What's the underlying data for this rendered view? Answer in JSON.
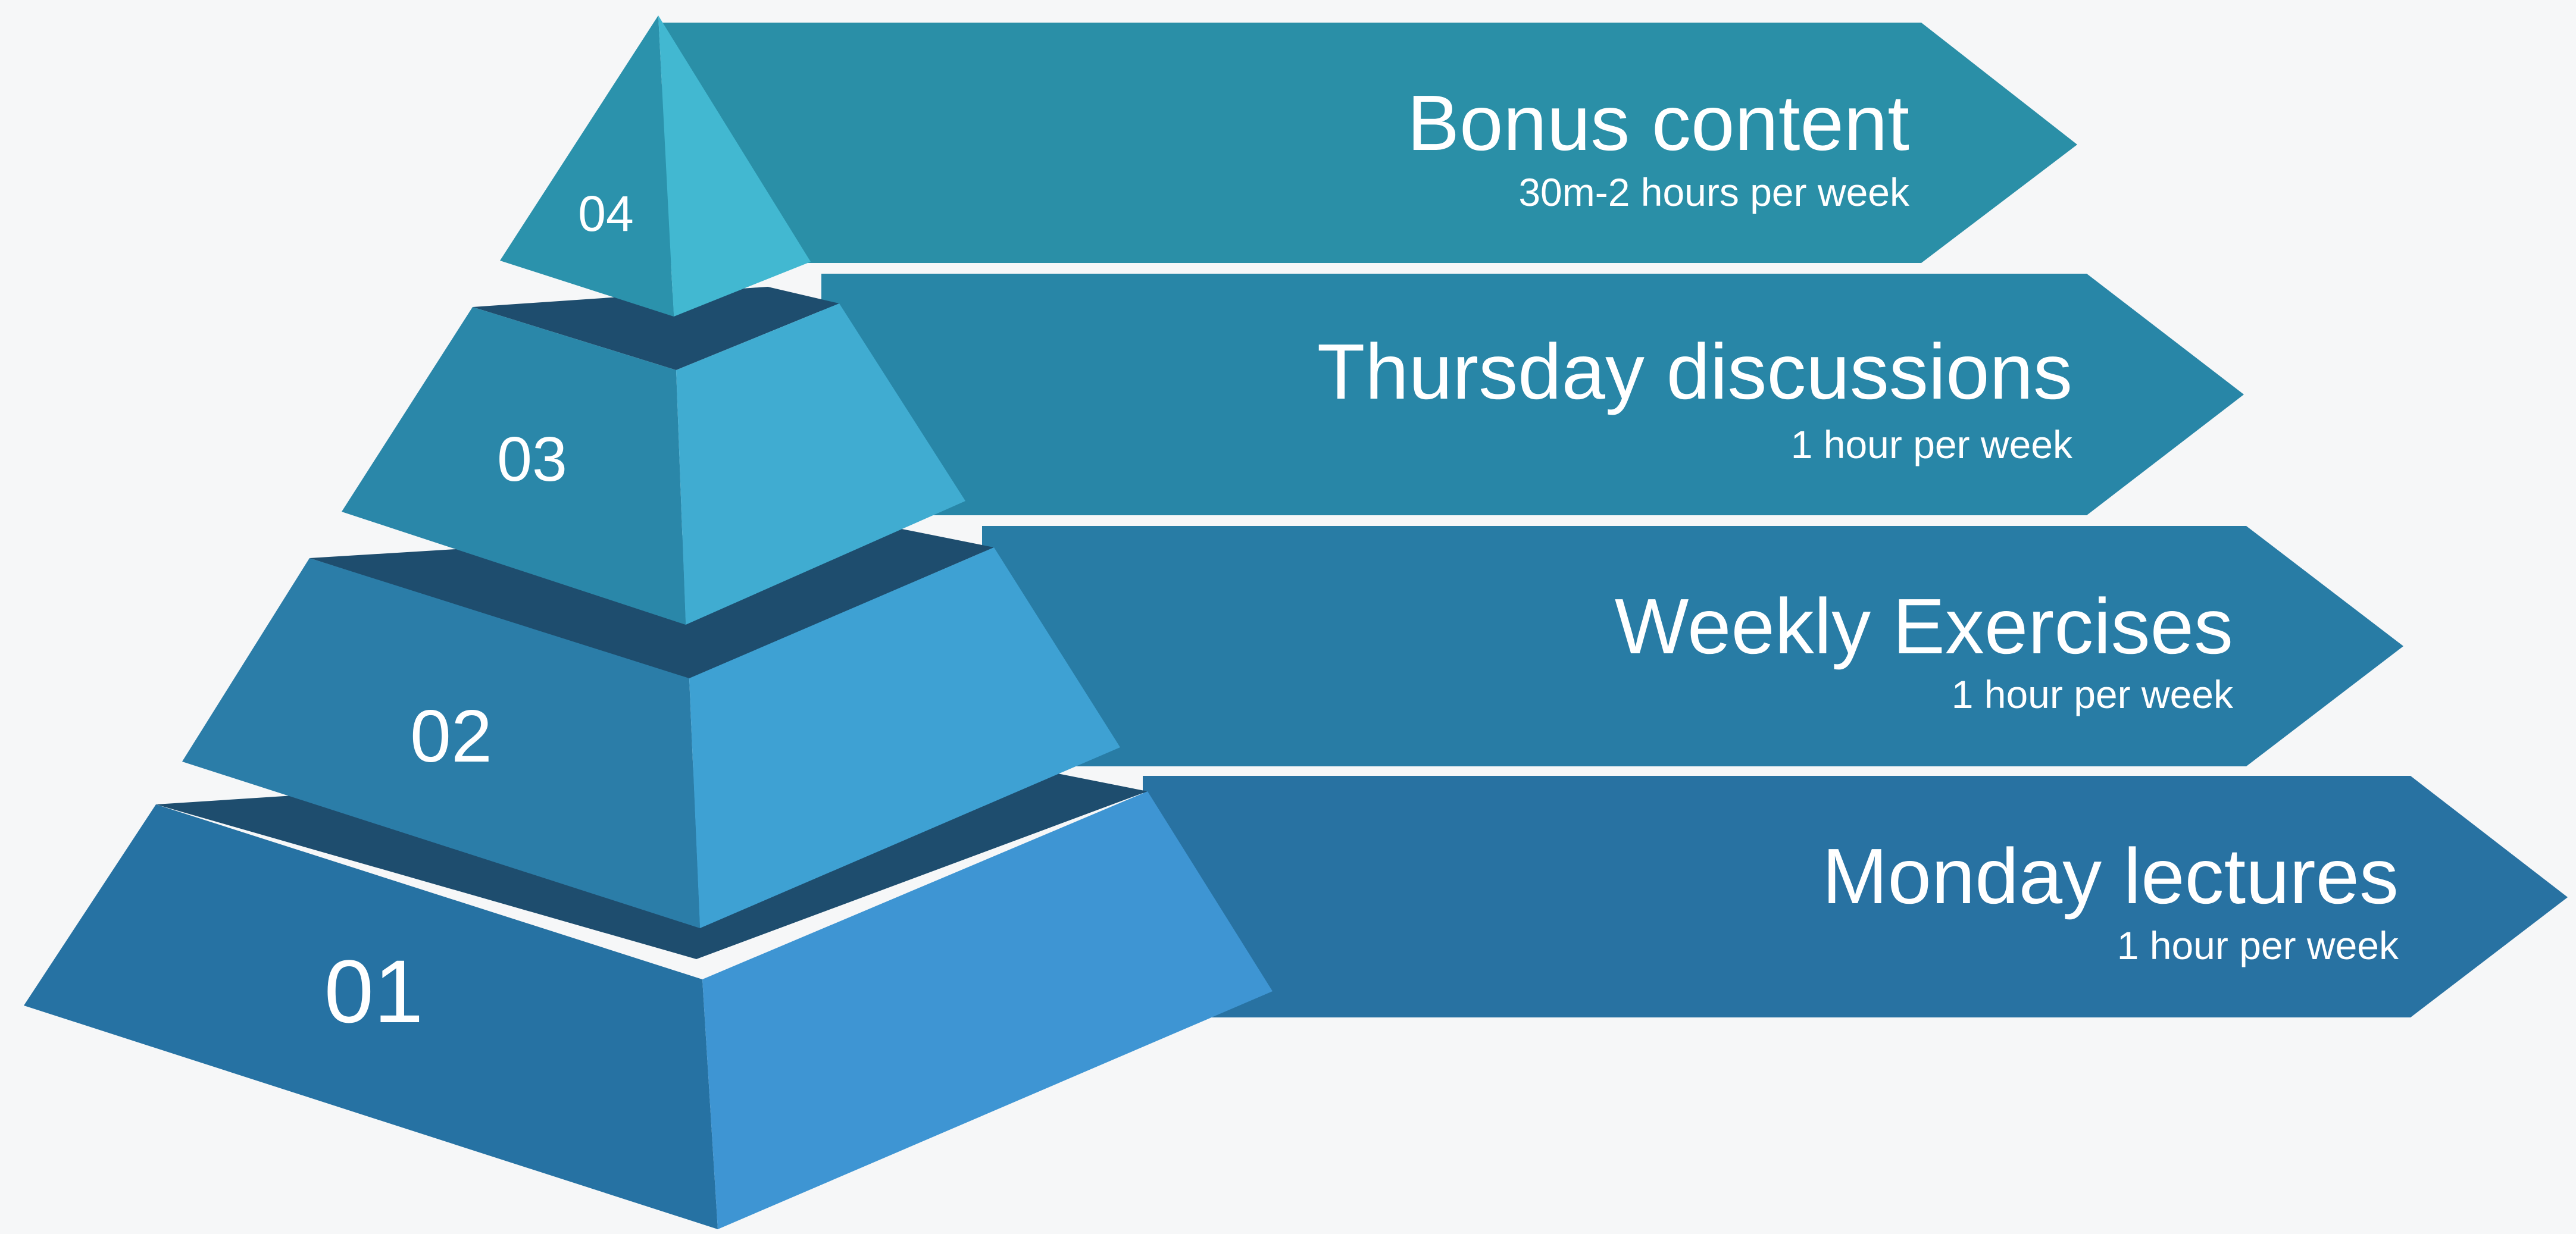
{
  "levels": [
    {
      "number": "01",
      "title": "Monday lectures",
      "subtitle": "1 hour per week"
    },
    {
      "number": "02",
      "title": "Weekly Exercises",
      "subtitle": "1 hour per week"
    },
    {
      "number": "03",
      "title": "Thursday discussions",
      "subtitle": "1 hour per week"
    },
    {
      "number": "04",
      "title": "Bonus content",
      "subtitle": "30m-2 hours per week"
    }
  ],
  "colors": {
    "background": "#f6f7f8",
    "arrow_01": "#2872a2",
    "arrow_02": "#287ca5",
    "arrow_03": "#2886a7",
    "arrow_04": "#2a8fa7",
    "tier_front_01": "#2672a3",
    "tier_side_01": "#3e95d3",
    "tier_front_02": "#2b7da8",
    "tier_side_02": "#3ea1d3",
    "tier_front_03": "#2a87a9",
    "tier_side_03": "#40acd1",
    "tier_front_04": "#2b92ac",
    "tier_side_04": "#42b8d1",
    "tier_shadow": "#1e4d6e"
  }
}
